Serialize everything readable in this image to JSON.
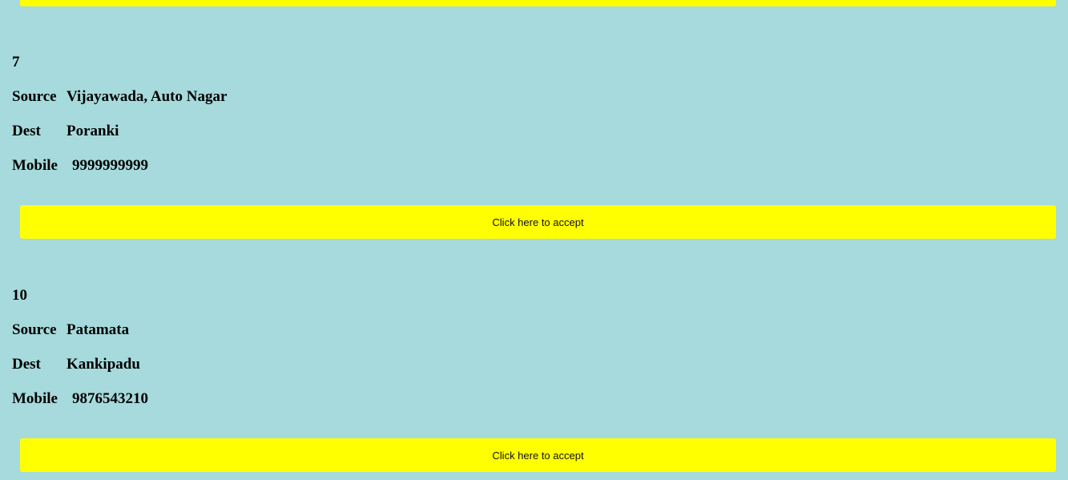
{
  "accept_label": "Click here to accept",
  "labels": {
    "source": "Source",
    "dest": "Dest",
    "mobile": "Mobile"
  },
  "requests": [
    {
      "id": "7",
      "source": "Vijayawada, Auto Nagar",
      "dest": "Poranki",
      "mobile": "9999999999"
    },
    {
      "id": "10",
      "source": "Patamata",
      "dest": "Kankipadu",
      "mobile": "9876543210"
    }
  ],
  "colors": {
    "background": "#a6dadc",
    "button": "#ffff00"
  }
}
